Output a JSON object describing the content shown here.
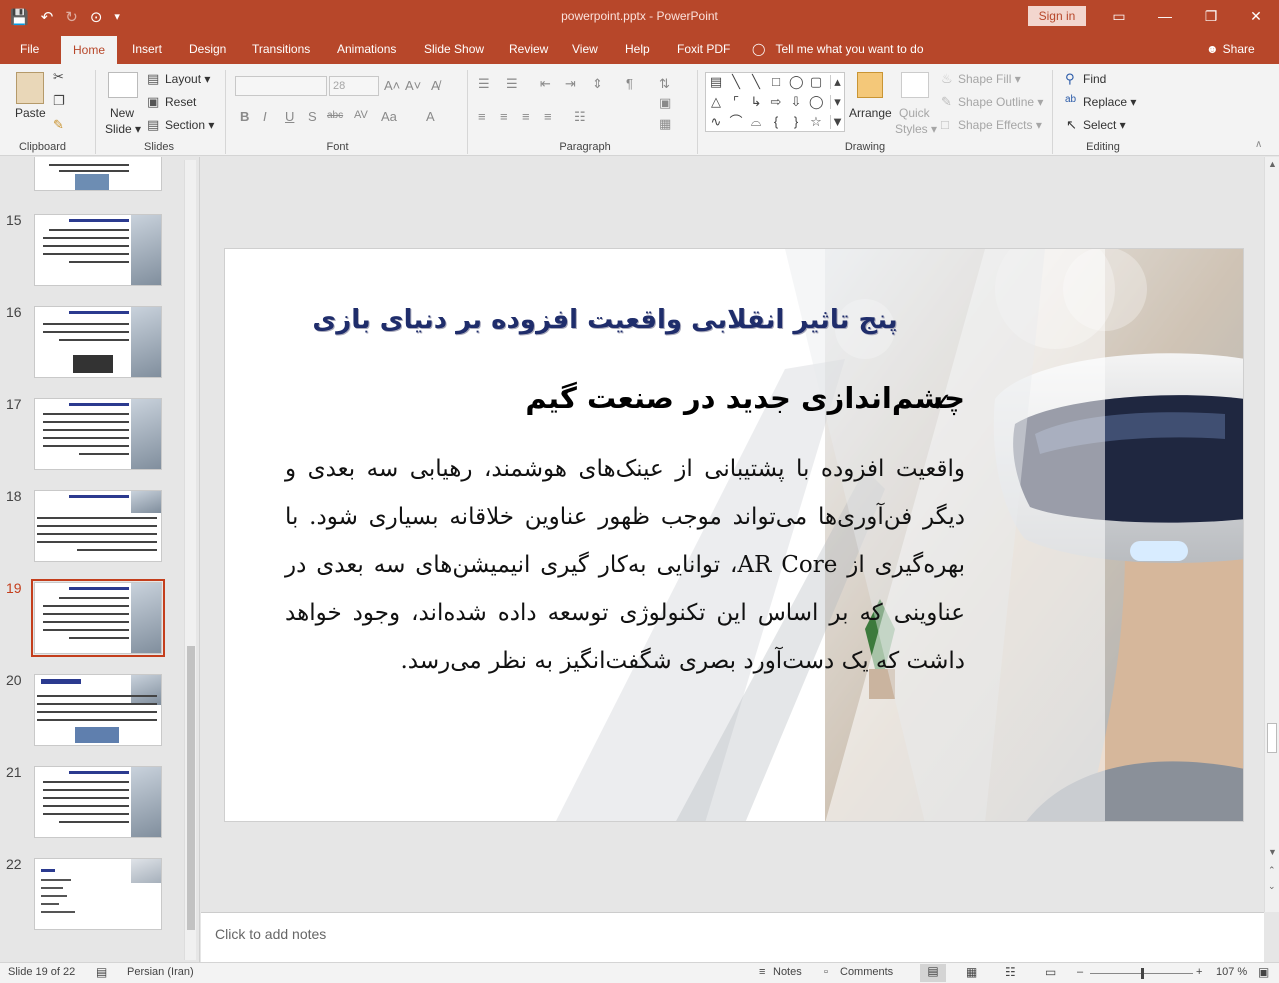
{
  "titlebar": {
    "doc_title": "powerpoint.pptx - PowerPoint",
    "sign_in": "Sign in",
    "qat": {
      "save": "💾",
      "undo": "↶",
      "redo": "↻",
      "present": "⊙",
      "customize": "▾"
    },
    "controls": {
      "ribbon_display": "▭",
      "minimize": "—",
      "restore": "❐",
      "close": "✕"
    }
  },
  "tabs": [
    "File",
    "Home",
    "Insert",
    "Design",
    "Transitions",
    "Animations",
    "Slide Show",
    "Review",
    "View",
    "Help",
    "Foxit PDF"
  ],
  "tell_me": "Tell me what you want to do",
  "share": "Share",
  "ribbon": {
    "clipboard": {
      "label": "Clipboard",
      "paste": "Paste"
    },
    "slides": {
      "label": "Slides",
      "new_slide_1": "New",
      "new_slide_2": "Slide ▾",
      "layout": "Layout ▾",
      "reset": "Reset",
      "section": "Section ▾"
    },
    "font": {
      "label": "Font",
      "size": "28",
      "bold": "B",
      "italic": "I",
      "underline": "U",
      "shadow": "S",
      "strike": "abc",
      "spacing": "AV",
      "case": "Aa",
      "color": "A",
      "grow": "A˄",
      "shrink": "A˅",
      "clear": "A̸"
    },
    "paragraph": {
      "label": "Paragraph"
    },
    "drawing": {
      "label": "Drawing",
      "arrange": "Arrange",
      "quick_styles_1": "Quick",
      "quick_styles_2": "Styles ▾",
      "shape_fill": "Shape Fill ▾",
      "shape_outline": "Shape Outline ▾",
      "shape_effects": "Shape Effects ▾"
    },
    "editing": {
      "label": "Editing",
      "find": "Find",
      "replace": "Replace ▾",
      "select": "Select ▾"
    }
  },
  "thumbnails": [
    {
      "num": "15"
    },
    {
      "num": "16"
    },
    {
      "num": "17"
    },
    {
      "num": "18"
    },
    {
      "num": "19"
    },
    {
      "num": "20"
    },
    {
      "num": "21"
    },
    {
      "num": "22"
    }
  ],
  "slide": {
    "title": "پنج تاثیر انقلابی واقعیت افزوده بر دنیای بازی",
    "check": "✓",
    "subtitle": "چشم‌اندازی جدید در صنعت گیم",
    "body": "واقعیت افزوده با پشتیبانی از عینک‌های هوشمند، رهیابی سه بعدی و دیگر فن‌آوری‌ها می‌تواند موجب ظهور عناوین خلاقانه بسیاری شود. با بهره‌گیری از AR Core، توانایی به‌کار گیری انیمیشن‌های سه بعدی در عناوینی که بر اساس این تکنولوژی توسعه داده شده‌اند، وجود خواهد داشت که یک دست‌آورد بصری شگفت‌انگیز به نظر می‌رسد."
  },
  "notes_placeholder": "Click to add notes",
  "status": {
    "slide_of": "Slide 19 of 22",
    "language": "Persian (Iran)",
    "notes": "Notes",
    "comments": "Comments",
    "zoom": "107 %"
  },
  "colors": {
    "accent": "#b7472a",
    "title_blue": "#1f2d6b",
    "active_thumb": "#c43e1c"
  }
}
